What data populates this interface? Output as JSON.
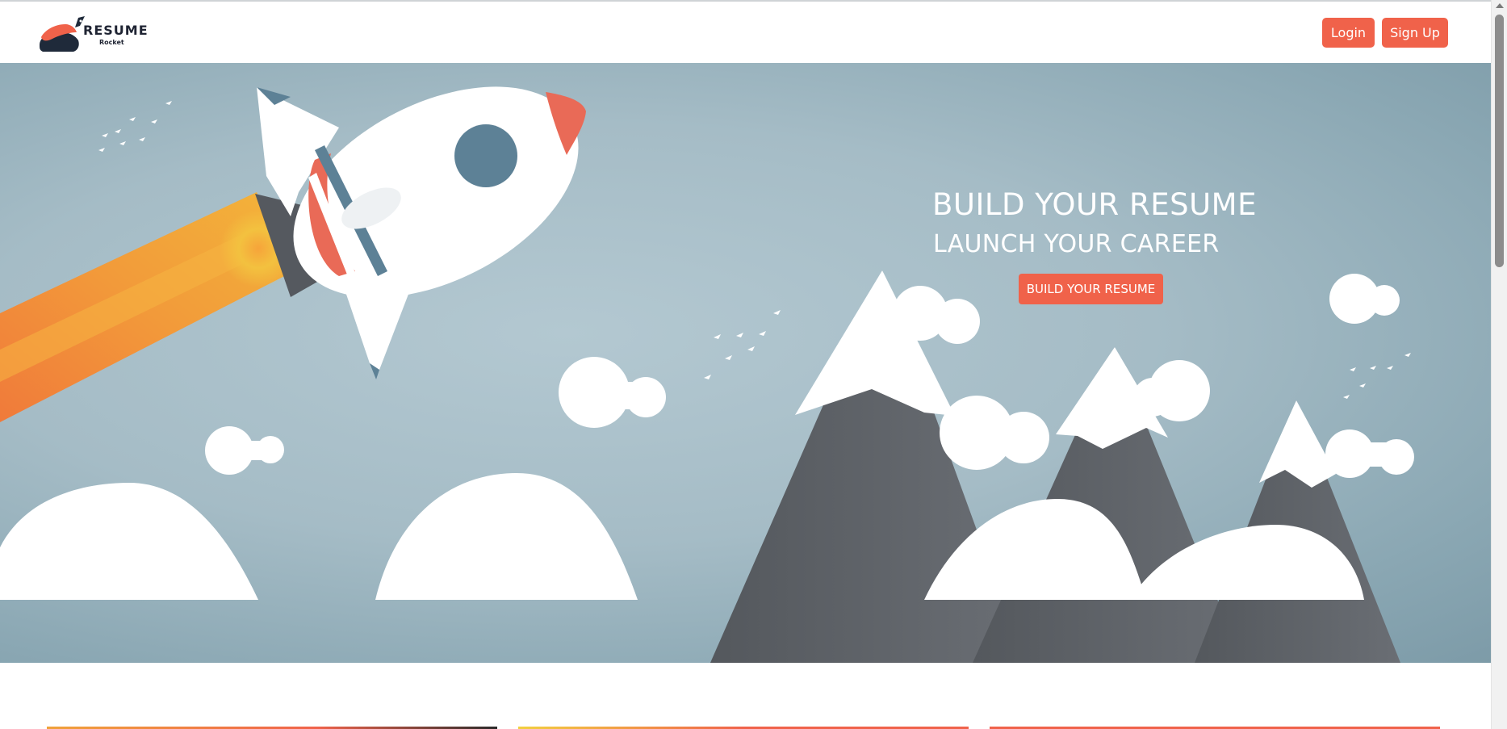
{
  "brand": {
    "name": "RESUME",
    "tagline": "Rocket"
  },
  "nav": {
    "login_label": "Login",
    "signup_label": "Sign Up"
  },
  "hero": {
    "title": "BUILD YOUR RESUME",
    "subtitle": "LAUNCH YOUR CAREER",
    "cta_label": "BUILD YOUR RESUME"
  },
  "colors": {
    "accent": "#f0624a",
    "hero_bg": "#a9c0ca",
    "mountain": "#5d6167",
    "cloud": "#ffffff"
  },
  "icons": [
    "rocket-logo-icon",
    "rocket-illustration",
    "mountains-illustration",
    "clouds-illustration",
    "birds-illustration"
  ]
}
